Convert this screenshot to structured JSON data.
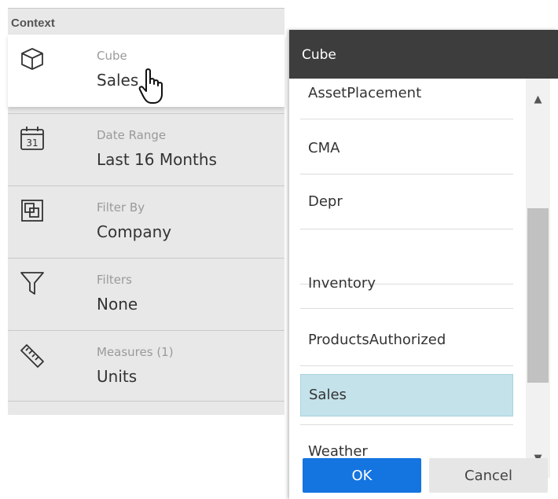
{
  "context": {
    "header": "Context",
    "rows": [
      {
        "label": "Cube",
        "value": "Sales",
        "icon": "cube-icon"
      },
      {
        "label": "Date Range",
        "value": "Last 16 Months",
        "icon": "calendar-icon",
        "icon_text": "31"
      },
      {
        "label": "Filter By",
        "value": "Company",
        "icon": "filter-by-icon"
      },
      {
        "label": "Filters",
        "value": "None",
        "icon": "funnel-icon"
      },
      {
        "label": "Measures (1)",
        "value": "Units",
        "icon": "ruler-icon"
      }
    ]
  },
  "dialog": {
    "title": "Cube",
    "items": [
      "AssetPlacement",
      "CMA",
      "Depr",
      "Inventory",
      "ProductsAuthorized",
      "Sales",
      "Weather"
    ],
    "selected": "Sales",
    "ok_label": "OK",
    "cancel_label": "Cancel",
    "colors": {
      "ok": "#1474e0",
      "selected": "#c4e2ea",
      "header": "#3d3d3d"
    }
  }
}
